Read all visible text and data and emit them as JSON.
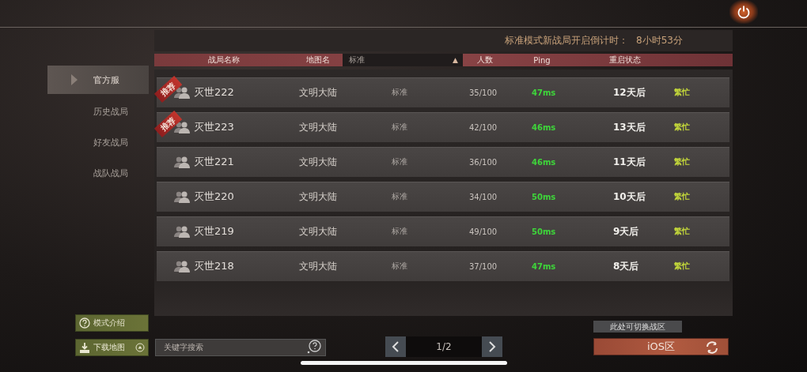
{
  "countdown": {
    "label": "标准模式新战局开启倒计时：",
    "value": "8小时53分"
  },
  "sidebar": {
    "items": [
      {
        "label": "官方服",
        "selected": true
      },
      {
        "label": "历史战局",
        "selected": false
      },
      {
        "label": "好友战局",
        "selected": false
      },
      {
        "label": "战队战局",
        "selected": false
      }
    ]
  },
  "table": {
    "columns": [
      "战局名称",
      "地图名",
      "人数",
      "Ping",
      "重启状态"
    ],
    "mode_filter": {
      "value": "标准",
      "arrow": "▲"
    },
    "rows": [
      {
        "recommended": true,
        "badge": "推荐",
        "name": "灭世222",
        "map": "文明大陆",
        "mode": "标准",
        "players": "35/100",
        "ping": "47ms",
        "restart": "12天后",
        "status": "繁忙"
      },
      {
        "recommended": true,
        "badge": "推荐",
        "name": "灭世223",
        "map": "文明大陆",
        "mode": "标准",
        "players": "42/100",
        "ping": "46ms",
        "restart": "13天后",
        "status": "繁忙"
      },
      {
        "recommended": false,
        "name": "灭世221",
        "map": "文明大陆",
        "mode": "标准",
        "players": "36/100",
        "ping": "46ms",
        "restart": "11天后",
        "status": "繁忙"
      },
      {
        "recommended": false,
        "name": "灭世220",
        "map": "文明大陆",
        "mode": "标准",
        "players": "34/100",
        "ping": "50ms",
        "restart": "10天后",
        "status": "繁忙"
      },
      {
        "recommended": false,
        "name": "灭世219",
        "map": "文明大陆",
        "mode": "标准",
        "players": "49/100",
        "ping": "50ms",
        "restart": "9天后",
        "status": "繁忙"
      },
      {
        "recommended": false,
        "name": "灭世218",
        "map": "文明大陆",
        "mode": "标准",
        "players": "37/100",
        "ping": "47ms",
        "restart": "8天后",
        "status": "繁忙"
      }
    ]
  },
  "buttons": {
    "mode_intro": "模式介绍",
    "download_map": "下载地图"
  },
  "search": {
    "placeholder": "关键字搜索"
  },
  "pager": {
    "page": "1/2"
  },
  "region": {
    "tooltip": "此处可切换战区",
    "label": "iOS区"
  }
}
